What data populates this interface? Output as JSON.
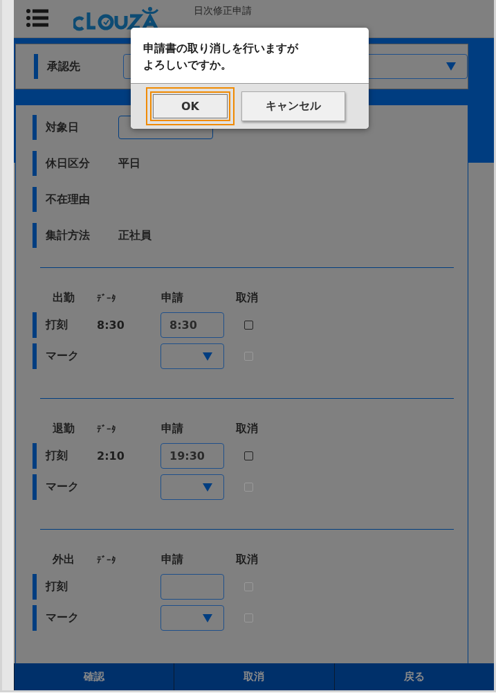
{
  "header": {
    "title": "日次修正申請"
  },
  "approver": {
    "label": "承認先"
  },
  "info_rows": [
    {
      "label": "対象日",
      "kind": "date"
    },
    {
      "label": "休日区分",
      "kind": "text",
      "value": "平日"
    },
    {
      "label": "不在理由",
      "kind": "text"
    },
    {
      "label": "集計方法",
      "kind": "text",
      "value": "正社員"
    }
  ],
  "groups": [
    {
      "title": "出勤",
      "col_data": "ﾃﾞｰﾀ",
      "col_request": "申請",
      "col_cancel": "取消",
      "rows": [
        {
          "label": "打刻",
          "kind": "time",
          "data": "8:30",
          "value": "8:30",
          "cancel_checked": false,
          "cancel_disabled": false
        },
        {
          "label": "マーク",
          "kind": "select",
          "cancel_checked": false,
          "cancel_disabled": true
        }
      ]
    },
    {
      "title": "退勤",
      "col_data": "ﾃﾞｰﾀ",
      "col_request": "申請",
      "col_cancel": "取消",
      "rows": [
        {
          "label": "打刻",
          "kind": "time",
          "data": "2:10",
          "value": "19:30",
          "cancel_checked": false,
          "cancel_disabled": false
        },
        {
          "label": "マーク",
          "kind": "select",
          "cancel_checked": false,
          "cancel_disabled": true
        }
      ]
    },
    {
      "title": "外出",
      "col_data": "ﾃﾞｰﾀ",
      "col_request": "申請",
      "col_cancel": "取消",
      "rows": [
        {
          "label": "打刻",
          "kind": "time",
          "cancel_checked": false,
          "cancel_disabled": true
        },
        {
          "label": "マーク",
          "kind": "select",
          "cancel_checked": false,
          "cancel_disabled": true
        }
      ]
    }
  ],
  "footer": [
    "確認",
    "取消",
    "戻る"
  ],
  "dialog": {
    "message": "申請書の取り消しを行いますがよろしいですか。",
    "buttons": [
      {
        "label": "OK",
        "focused": true
      },
      {
        "label": "キャンセル",
        "focused": false
      }
    ]
  }
}
